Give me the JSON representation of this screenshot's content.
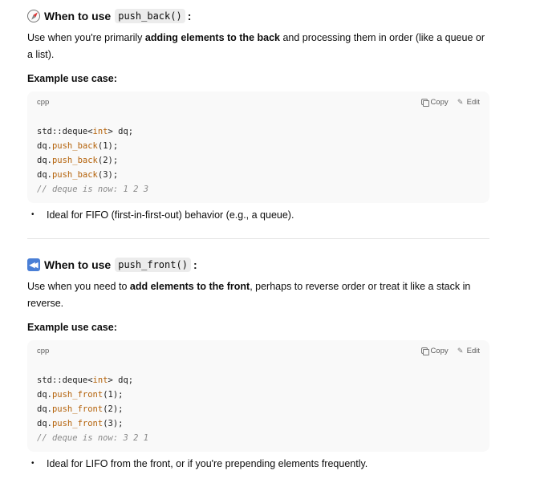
{
  "section1": {
    "heading_prefix": "When to use",
    "heading_code": "push_back()",
    "heading_suffix": ":",
    "para_pre": "Use when you're primarily ",
    "para_bold": "adding elements to the back",
    "para_post": " and processing them in order (like a queue or a list).",
    "example_label": "Example use case:",
    "code_lang": "cpp",
    "copy_label": "Copy",
    "edit_label": "Edit",
    "code": {
      "l1a": "std::deque<",
      "l1kw": "int",
      "l1b": "> dq;",
      "l2a": "dq.",
      "l2kw": "push_back",
      "l2b": "(1);",
      "l3a": "dq.",
      "l3kw": "push_back",
      "l3b": "(2);",
      "l4a": "dq.",
      "l4kw": "push_back",
      "l4b": "(3);",
      "comment": "// deque is now: 1 2 3"
    },
    "bullet": "Ideal for FIFO (first-in-first-out) behavior (e.g., a queue)."
  },
  "section2": {
    "heading_prefix": "When to use",
    "heading_code": "push_front()",
    "heading_suffix": ":",
    "para_pre": "Use when you need to ",
    "para_bold": "add elements to the front",
    "para_post": ", perhaps to reverse order or treat it like a stack in reverse.",
    "example_label": "Example use case:",
    "code_lang": "cpp",
    "copy_label": "Copy",
    "edit_label": "Edit",
    "code": {
      "l1a": "std::deque<",
      "l1kw": "int",
      "l1b": "> dq;",
      "l2a": "dq.",
      "l2kw": "push_front",
      "l2b": "(1);",
      "l3a": "dq.",
      "l3kw": "push_front",
      "l3b": "(2);",
      "l4a": "dq.",
      "l4kw": "push_front",
      "l4b": "(3);",
      "comment": "// deque is now: 3 2 1"
    },
    "bullet": "Ideal for LIFO from the front, or if you're prepending elements frequently."
  },
  "icons": {
    "section1_icon": "compass-icon",
    "section2_icon": "rewind-icon",
    "copy_icon": "copy-icon",
    "edit_icon": "pencil-icon"
  },
  "colors": {
    "code_keyword": "#b4620a",
    "code_comment": "#8a8a8a",
    "code_bg": "#f9f9f9"
  }
}
